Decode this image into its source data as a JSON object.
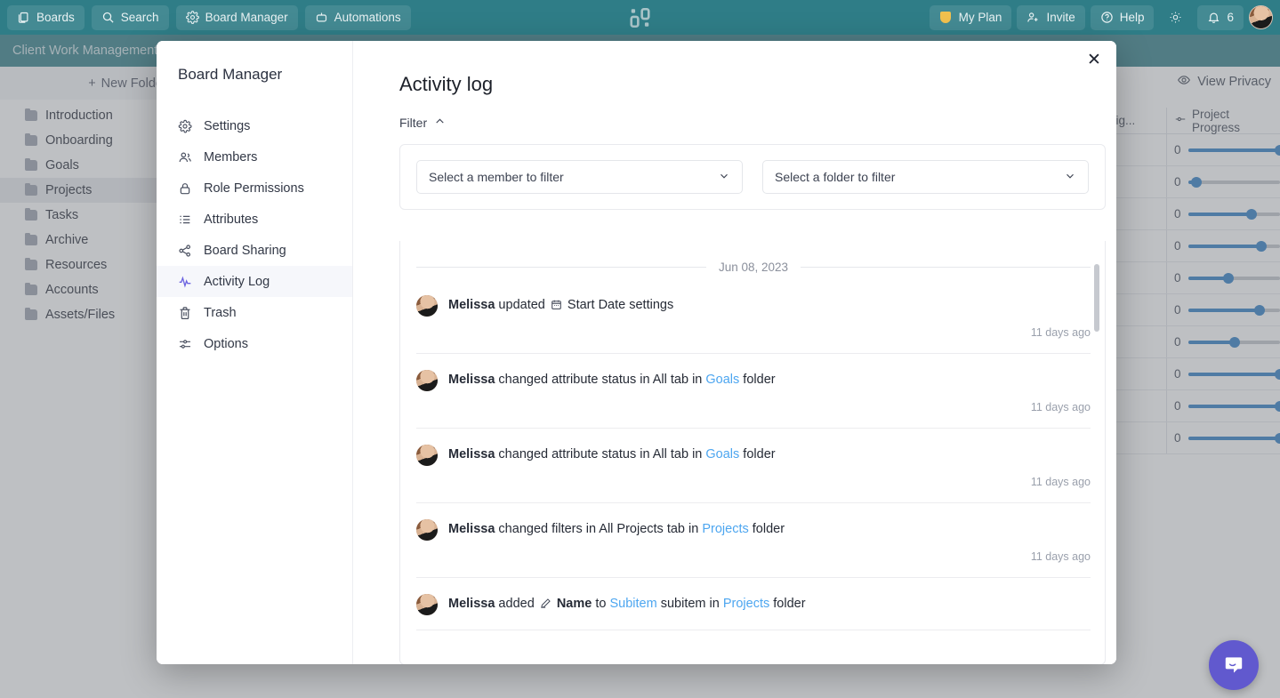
{
  "topbar": {
    "left_buttons": [
      {
        "label": "Boards",
        "icon": "boards-icon"
      },
      {
        "label": "Search",
        "icon": "search-icon"
      },
      {
        "label": "Board Manager",
        "icon": "gear-icon"
      },
      {
        "label": "Automations",
        "icon": "automation-icon"
      }
    ],
    "logo": "app-logo",
    "right_buttons": [
      {
        "label": "My Plan",
        "icon": "shield-icon"
      },
      {
        "label": "Invite",
        "icon": "user-plus-icon"
      },
      {
        "label": "Help",
        "icon": "question-circle-icon"
      }
    ],
    "theme_toggle_icon": "sun-icon",
    "notifications": {
      "icon": "bell-icon",
      "count": "6"
    },
    "avatar": "user-avatar"
  },
  "board": {
    "title": "Client Work Management",
    "new_folder_label": "New Folder",
    "view_privacy_label": "View Privacy",
    "folders": [
      {
        "label": "Introduction",
        "active": false
      },
      {
        "label": "Onboarding",
        "active": false
      },
      {
        "label": "Goals",
        "active": false
      },
      {
        "label": "Projects",
        "active": true
      },
      {
        "label": "Tasks",
        "active": false
      },
      {
        "label": "Archive",
        "active": false
      },
      {
        "label": "Resources",
        "active": false
      },
      {
        "label": "Accounts",
        "active": false
      },
      {
        "label": "Assets/Files",
        "active": false
      }
    ]
  },
  "table": {
    "columns": [
      {
        "label": "Assig...",
        "icon": ""
      },
      {
        "label": "Project Progress",
        "icon": "slider-icon"
      }
    ],
    "rows": [
      {
        "assignee": "user-avatar",
        "value": "0",
        "percent": 100
      },
      {
        "assignee": "user-avatar",
        "value": "0",
        "percent": 9
      },
      {
        "assignee": "user-avatar",
        "value": "0",
        "percent": 69
      },
      {
        "assignee": "user-avatar",
        "value": "0",
        "percent": 80
      },
      {
        "assignee": "user-avatar",
        "value": "0",
        "percent": 44
      },
      {
        "assignee": "user-avatar",
        "value": "0",
        "percent": 78
      },
      {
        "assignee": "user-avatar",
        "value": "0",
        "percent": 51
      },
      {
        "assignee": "user-avatar",
        "value": "0",
        "percent": 100
      },
      {
        "assignee": "user-avatar",
        "value": "0",
        "percent": 100
      },
      {
        "assignee": "user-avatar",
        "value": "0",
        "percent": 100
      }
    ]
  },
  "modal": {
    "nav_title": "Board Manager",
    "nav_items": [
      {
        "label": "Settings",
        "icon": "gear-icon",
        "active": false
      },
      {
        "label": "Members",
        "icon": "users-icon",
        "active": false
      },
      {
        "label": "Role Permissions",
        "icon": "lock-icon",
        "active": false
      },
      {
        "label": "Attributes",
        "icon": "list-icon",
        "active": false
      },
      {
        "label": "Board Sharing",
        "icon": "share-icon",
        "active": false
      },
      {
        "label": "Activity Log",
        "icon": "activity-pulse-icon",
        "active": true
      },
      {
        "label": "Trash",
        "icon": "trash-icon",
        "active": false
      },
      {
        "label": "Options",
        "icon": "sliders-icon",
        "active": false
      }
    ],
    "close_label": "✕",
    "title": "Activity log",
    "filter_label": "Filter",
    "filter_chevron": "chevron-up-icon",
    "member_select_placeholder": "Select a member to filter",
    "folder_select_placeholder": "Select a folder to filter",
    "date_group": "Jun 08, 2023",
    "entries": [
      {
        "actor": "Melissa",
        "parts": [
          {
            "t": "text",
            "v": " updated "
          },
          {
            "t": "icon",
            "v": "calendar-icon"
          },
          {
            "t": "text",
            "v": " Start Date settings"
          }
        ],
        "time": "11 days ago"
      },
      {
        "actor": "Melissa",
        "parts": [
          {
            "t": "text",
            "v": " changed attribute status in All tab in "
          },
          {
            "t": "link",
            "v": "Goals"
          },
          {
            "t": "text",
            "v": " folder"
          }
        ],
        "time": "11 days ago"
      },
      {
        "actor": "Melissa",
        "parts": [
          {
            "t": "text",
            "v": " changed attribute status in All tab in "
          },
          {
            "t": "link",
            "v": "Goals"
          },
          {
            "t": "text",
            "v": " folder"
          }
        ],
        "time": "11 days ago"
      },
      {
        "actor": "Melissa",
        "parts": [
          {
            "t": "text",
            "v": " changed filters in All Projects tab in "
          },
          {
            "t": "link",
            "v": "Projects"
          },
          {
            "t": "text",
            "v": " folder"
          }
        ],
        "time": "11 days ago"
      },
      {
        "actor": "Melissa",
        "parts": [
          {
            "t": "text",
            "v": " added "
          },
          {
            "t": "icon",
            "v": "pencil-icon"
          },
          {
            "t": "bold",
            "v": " Name"
          },
          {
            "t": "text",
            "v": " to "
          },
          {
            "t": "link",
            "v": "Subitem"
          },
          {
            "t": "text",
            "v": " subitem in "
          },
          {
            "t": "link",
            "v": "Projects"
          },
          {
            "t": "text",
            "v": " folder"
          }
        ],
        "time": ""
      }
    ]
  },
  "chat": {
    "icon": "chat-bubble-icon"
  },
  "colors": {
    "topbar": "#2f7d87",
    "accent_purple": "#6c63e0",
    "link_blue": "#4da6f0",
    "slider_blue": "#2b7cc4",
    "chat_purple": "#6159ce",
    "plan_yellow": "#f2c14e"
  }
}
